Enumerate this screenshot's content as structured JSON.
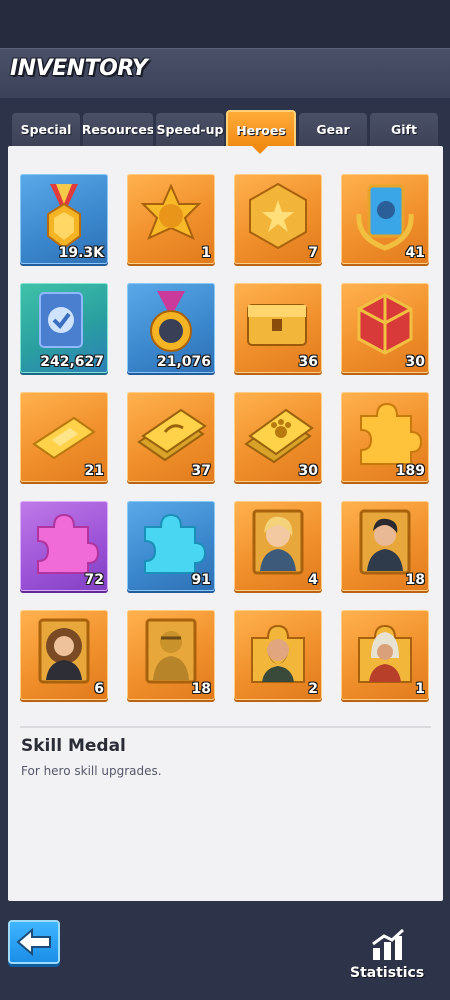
{
  "header": {
    "title": "INVENTORY"
  },
  "tabs": [
    {
      "label": "Special"
    },
    {
      "label": "Resources"
    },
    {
      "label": "Speed-up"
    },
    {
      "label": "Heroes",
      "active": true
    },
    {
      "label": "Gear"
    },
    {
      "label": "Gift"
    }
  ],
  "items": [
    {
      "icon": "skill-medal-icon",
      "count": "19.3K",
      "selected": true
    },
    {
      "icon": "gold-star-badge-icon",
      "count": "1"
    },
    {
      "icon": "hexagon-star-badge-icon",
      "count": "7"
    },
    {
      "icon": "laurel-hero-card-icon",
      "count": "41"
    },
    {
      "icon": "blue-check-card-icon",
      "count": "242,627"
    },
    {
      "icon": "gorilla-medal-icon",
      "count": "21,076"
    },
    {
      "icon": "treasure-chest-icon",
      "count": "36"
    },
    {
      "icon": "red-gold-cube-icon",
      "count": "30"
    },
    {
      "icon": "gold-bar-icon",
      "count": "21"
    },
    {
      "icon": "gold-wing-cards-icon",
      "count": "37"
    },
    {
      "icon": "gold-paw-cards-icon",
      "count": "30"
    },
    {
      "icon": "orange-puzzle-piece-icon",
      "count": "189"
    },
    {
      "icon": "purple-puzzle-piece-icon",
      "count": "72"
    },
    {
      "icon": "blue-puzzle-piece-icon",
      "count": "91"
    },
    {
      "icon": "hero-portrait-blonde-woman-icon",
      "count": "4"
    },
    {
      "icon": "hero-portrait-dark-hair-man-icon",
      "count": "18"
    },
    {
      "icon": "hero-portrait-curly-hair-woman-icon",
      "count": "6"
    },
    {
      "icon": "hero-portrait-gold-statue-icon",
      "count": "18"
    },
    {
      "icon": "hero-portrait-bearded-man-icon",
      "count": "2"
    },
    {
      "icon": "hero-portrait-hooded-figure-icon",
      "count": "1"
    }
  ],
  "detail": {
    "name": "Skill Medal",
    "description": "For hero skill upgrades."
  },
  "footer": {
    "back_icon": "left-arrow-icon",
    "statistics_label": "Statistics",
    "statistics_icon": "bar-chart-icon"
  },
  "colors": {
    "active_tab": "#f08a12",
    "slot_orange": "#f0902c",
    "selected_glow": "#ffd300",
    "back_button": "#1b8ee6"
  }
}
